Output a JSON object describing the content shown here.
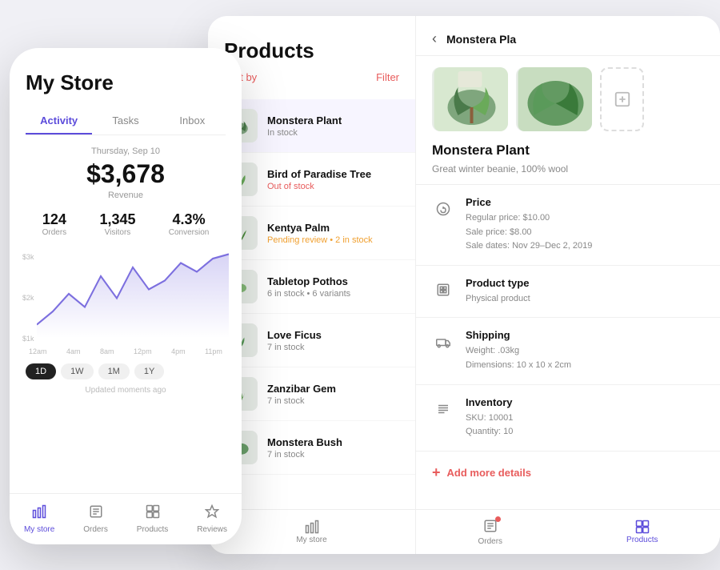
{
  "phone": {
    "title": "My Store",
    "tabs": [
      "Activity",
      "Tasks",
      "Inbox"
    ],
    "active_tab": "Activity",
    "date": "Thursday, Sep 10",
    "revenue": "$3,678",
    "revenue_label": "Revenue",
    "stats": [
      {
        "value": "124",
        "label": "Orders"
      },
      {
        "value": "1,345",
        "label": "Visitors"
      },
      {
        "value": "4.3%",
        "label": "Conversion"
      }
    ],
    "chart": {
      "y_labels": [
        "$3k",
        "$2k",
        "$1k"
      ],
      "x_labels": [
        "12am",
        "4am",
        "8am",
        "12pm",
        "4pm",
        "11pm"
      ]
    },
    "time_filters": [
      "1D",
      "1W",
      "1M",
      "1Y"
    ],
    "active_filter": "1D",
    "updated_text": "Updated moments ago",
    "nav": [
      {
        "icon": "chart-icon",
        "label": "My store"
      },
      {
        "icon": "orders-icon",
        "label": "Orders"
      },
      {
        "icon": "products-icon",
        "label": "Products"
      },
      {
        "icon": "reviews-icon",
        "label": "Reviews"
      }
    ]
  },
  "products_panel": {
    "title": "Products",
    "sort_by": "Sort by",
    "filter": "Filter",
    "items": [
      {
        "name": "Monstera Plant",
        "status": "In stock",
        "status_type": "in-stock",
        "selected": true
      },
      {
        "name": "Bird of Paradise Tree",
        "status": "Out of stock",
        "status_type": "out-stock",
        "selected": false
      },
      {
        "name": "Kentya Palm",
        "status": "Pending review • 2 in stock",
        "status_type": "pending",
        "selected": false
      },
      {
        "name": "Tabletop Pothos",
        "status": "6 in stock • 6 variants",
        "status_type": "in-stock",
        "selected": false
      },
      {
        "name": "Love Ficus",
        "status": "7 in stock",
        "status_type": "in-stock",
        "selected": false
      },
      {
        "name": "Zanzibar Gem",
        "status": "7 in stock",
        "status_type": "in-stock",
        "selected": false
      },
      {
        "name": "Monstera Bush",
        "status": "7 in stock",
        "status_type": "in-stock",
        "selected": false
      }
    ],
    "tablet_nav": [
      {
        "icon": "store-icon",
        "label": "My store"
      }
    ]
  },
  "detail_panel": {
    "back_label": "‹",
    "title": "Monstera Pla",
    "product_name": "Monstera Plant",
    "product_desc": "Great winter beanie, 100% wool",
    "add_image_icon": "⊞",
    "sections": [
      {
        "icon": "$",
        "title": "Price",
        "lines": [
          "Regular price: $10.00",
          "Sale price: $8.00",
          "Sale dates: Nov 29–Dec 2, 2019"
        ]
      },
      {
        "icon": "▣",
        "title": "Product type",
        "lines": [
          "Physical product"
        ]
      },
      {
        "icon": "🚚",
        "title": "Shipping",
        "lines": [
          "Weight: .03kg",
          "Dimensions: 10 x 10 x 2cm"
        ]
      },
      {
        "icon": "≋",
        "title": "Inventory",
        "lines": [
          "SKU: 10001",
          "Quantity: 10"
        ]
      }
    ],
    "add_more_label": "Add more details",
    "tab_nav": [
      {
        "icon": "orders-icon",
        "label": "Orders",
        "has_badge": true,
        "active": false
      },
      {
        "icon": "products-icon",
        "label": "Products",
        "active": true
      }
    ]
  }
}
